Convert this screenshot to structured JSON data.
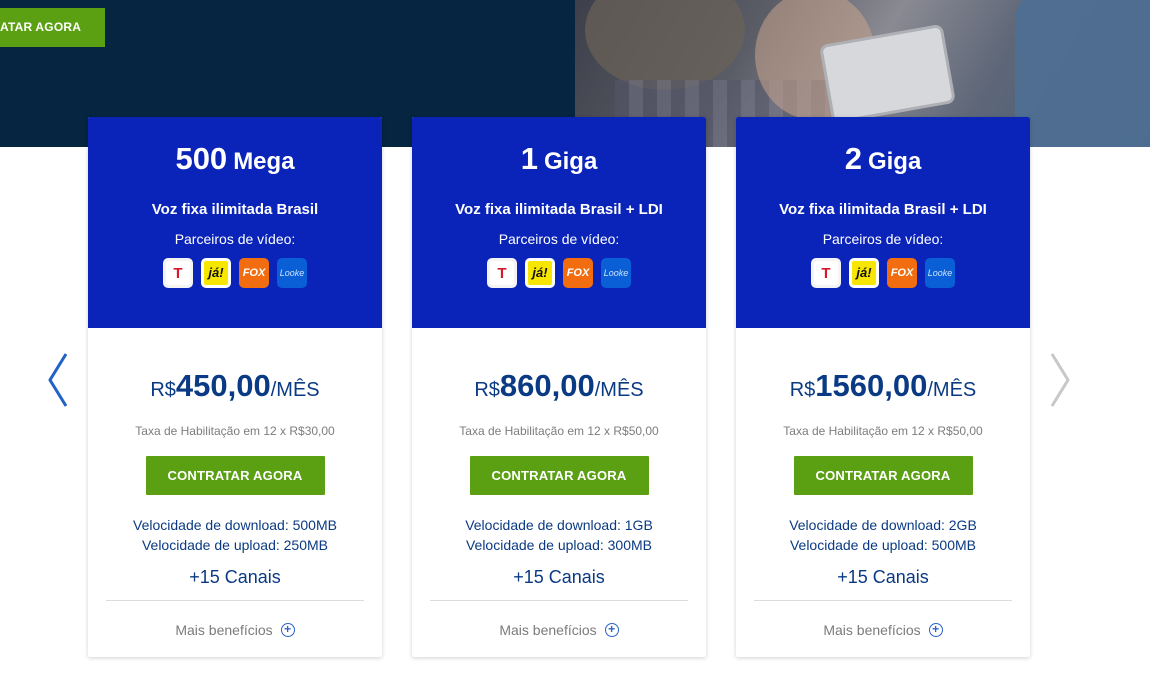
{
  "hero": {
    "cta_label": "ATAR AGORA"
  },
  "colors": {
    "hero_bg": "#062540",
    "card_header": "#0a23b9",
    "cta_green": "#5aa012",
    "text_blue": "#0b3a84",
    "arrow_left": "#2063c8",
    "arrow_right": "#c8c8c8"
  },
  "carousel": {
    "prev_icon": "chevron-left-icon",
    "next_icon": "chevron-right-icon"
  },
  "plans": [
    {
      "speed_number": "500",
      "speed_unit": "Mega",
      "voice": "Voz fixa ilimitada Brasil",
      "partners_label": "Parceiros de vídeo:",
      "partners": [
        "telecine-play-logo",
        "ja-logo",
        "fox-logo",
        "looke-logo"
      ],
      "currency": "R$",
      "price": "450,00",
      "period": "/MÊS",
      "fee": "Taxa de Habilitação em 12 x R$30,00",
      "cta": "CONTRATAR AGORA",
      "download": "Velocidade de download: 500MB",
      "upload": "Velocidade de upload: 250MB",
      "channels": "+15 Canais",
      "more": "Mais benefícios"
    },
    {
      "speed_number": "1",
      "speed_unit": "Giga",
      "voice": "Voz fixa ilimitada Brasil + LDI",
      "partners_label": "Parceiros de vídeo:",
      "partners": [
        "telecine-play-logo",
        "ja-logo",
        "fox-logo",
        "looke-logo"
      ],
      "currency": "R$",
      "price": "860,00",
      "period": "/MÊS",
      "fee": "Taxa de Habilitação em 12 x R$50,00",
      "cta": "CONTRATAR AGORA",
      "download": "Velocidade de download: 1GB",
      "upload": "Velocidade de upload: 300MB",
      "channels": "+15 Canais",
      "more": "Mais benefícios"
    },
    {
      "speed_number": "2",
      "speed_unit": "Giga",
      "voice": "Voz fixa ilimitada Brasil + LDI",
      "partners_label": "Parceiros de vídeo:",
      "partners": [
        "telecine-play-logo",
        "ja-logo",
        "fox-logo",
        "looke-logo"
      ],
      "currency": "R$",
      "price": "1560,00",
      "period": "/MÊS",
      "fee": "Taxa de Habilitação em 12 x R$50,00",
      "cta": "CONTRATAR AGORA",
      "download": "Velocidade de download: 2GB",
      "upload": "Velocidade de upload: 500MB",
      "channels": "+15 Canais",
      "more": "Mais benefícios"
    }
  ]
}
